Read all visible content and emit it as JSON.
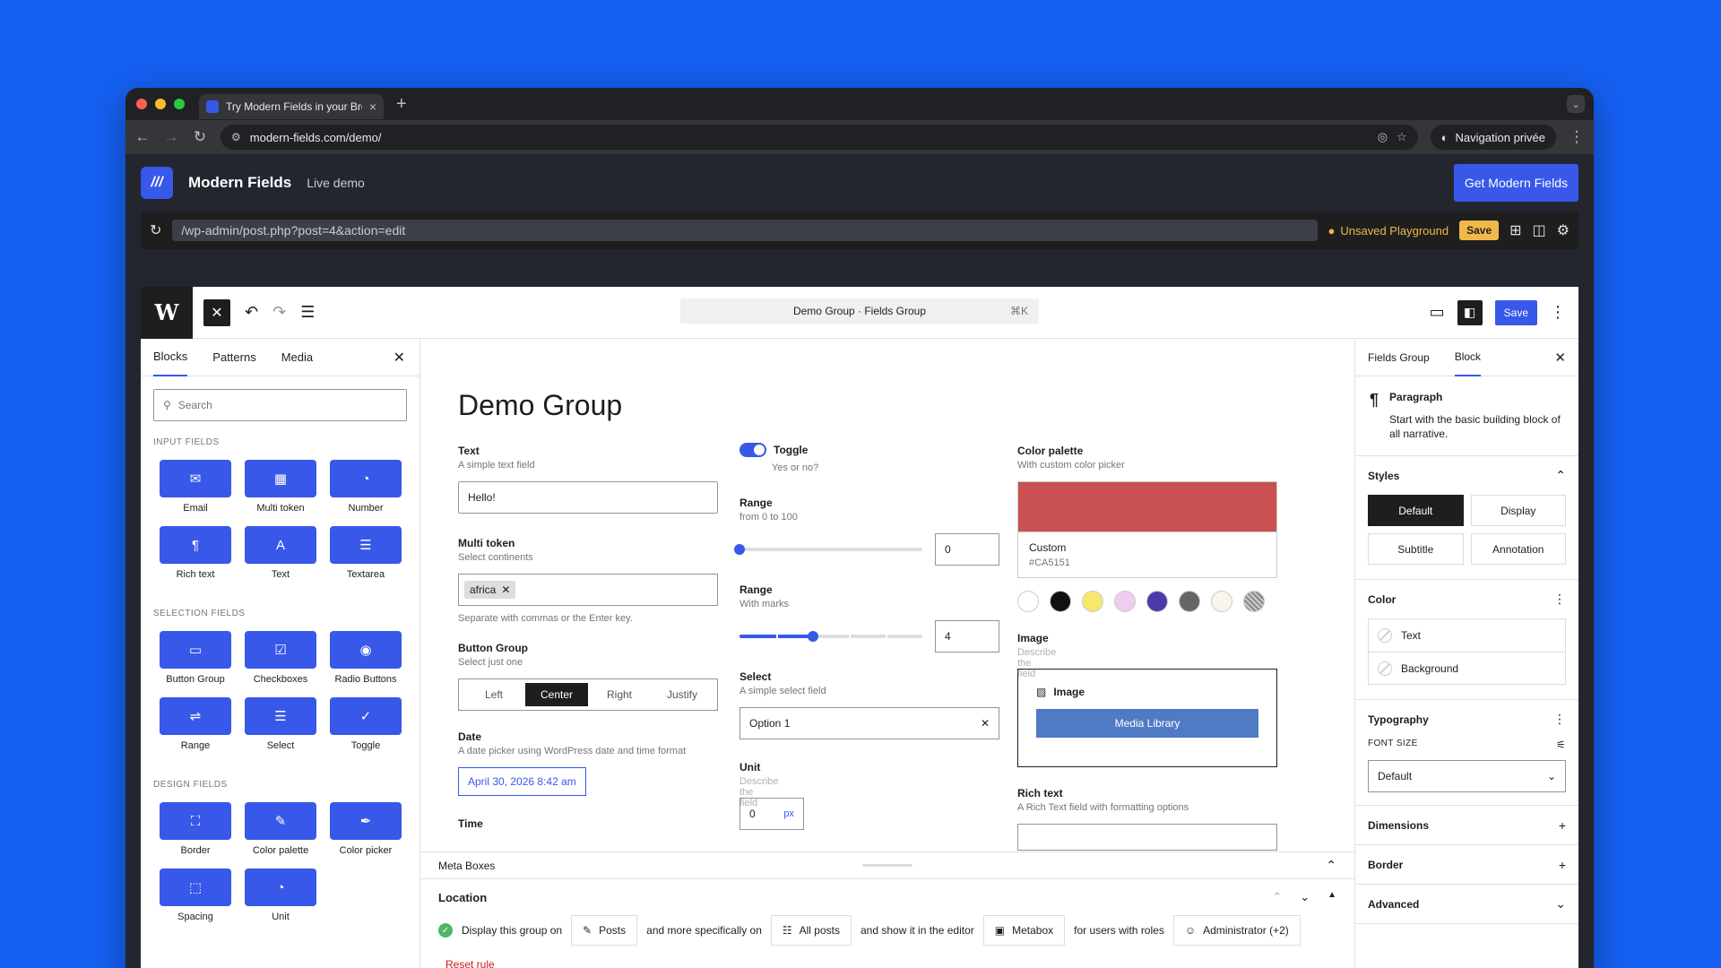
{
  "browser": {
    "tab_title": "Try Modern Fields in your Bro",
    "url": "modern-fields.com/demo/",
    "private_label": "Navigation privée"
  },
  "site": {
    "name": "Modern Fields",
    "live_label": "Live demo",
    "cta": "Get Modern Fields"
  },
  "playground": {
    "path": "/wp-admin/post.php?post=4&action=edit",
    "status": "Unsaved Playground",
    "save": "Save"
  },
  "editor": {
    "command_title": "Demo Group · Fields Group",
    "command_shortcut": "⌘K",
    "save_label": "Save"
  },
  "inserter": {
    "tabs": [
      "Blocks",
      "Patterns",
      "Media"
    ],
    "search_placeholder": "Search",
    "groups": [
      {
        "title": "INPUT FIELDS",
        "items": [
          {
            "label": "Email",
            "icon": "✉"
          },
          {
            "label": "Multi token",
            "icon": "▦"
          },
          {
            "label": "Number",
            "icon": "◔"
          },
          {
            "label": "Rich text",
            "icon": "¶"
          },
          {
            "label": "Text",
            "icon": "A"
          },
          {
            "label": "Textarea",
            "icon": "☰"
          }
        ]
      },
      {
        "title": "SELECTION FIELDS",
        "items": [
          {
            "label": "Button Group",
            "icon": "▭"
          },
          {
            "label": "Checkboxes",
            "icon": "☑"
          },
          {
            "label": "Radio Buttons",
            "icon": "◉"
          },
          {
            "label": "Range",
            "icon": "⇌"
          },
          {
            "label": "Select",
            "icon": "☰"
          },
          {
            "label": "Toggle",
            "icon": "✓"
          }
        ]
      },
      {
        "title": "DESIGN FIELDS",
        "items": [
          {
            "label": "Border",
            "icon": "⛶"
          },
          {
            "label": "Color palette",
            "icon": "✎"
          },
          {
            "label": "Color picker",
            "icon": "✒"
          },
          {
            "label": "Spacing",
            "icon": "⬚"
          },
          {
            "label": "Unit",
            "icon": "◔"
          }
        ]
      }
    ]
  },
  "canvas": {
    "title": "Demo Group",
    "text_field": {
      "label": "Text",
      "desc": "A simple text field",
      "value": "Hello!"
    },
    "multi_token": {
      "label": "Multi token",
      "desc": "Select continents",
      "token": "africa",
      "help": "Separate with commas or the Enter key."
    },
    "button_group": {
      "label": "Button Group",
      "desc": "Select just one",
      "options": [
        "Left",
        "Center",
        "Right",
        "Justify"
      ],
      "selected": "Center"
    },
    "date": {
      "label": "Date",
      "desc": "A date picker using WordPress date and time format",
      "value": "April 30, 2026 8:42 am"
    },
    "time": {
      "label": "Time"
    },
    "toggle": {
      "label": "Toggle",
      "desc": "Yes or no?"
    },
    "range1": {
      "label": "Range",
      "desc": "from 0 to 100",
      "value": "0",
      "level": 0
    },
    "range2": {
      "label": "Range",
      "desc": "With marks",
      "value": "4",
      "level": 0.4
    },
    "select": {
      "label": "Select",
      "desc": "A simple select field",
      "value": "Option 1"
    },
    "unit": {
      "label": "Unit",
      "desc": "Describe the field",
      "value": "0",
      "unit": "px"
    },
    "color_palette": {
      "label": "Color palette",
      "desc": "With custom color picker",
      "name": "Custom",
      "hex": "#CA5151",
      "color": "#ca5151",
      "swatches": [
        "#ffffff",
        "#111111",
        "#f7e76a",
        "#eecdf0",
        "#4b3aa8",
        "#666666",
        "#f8f5ea",
        "#999999"
      ]
    },
    "image": {
      "label": "Image",
      "desc": "Describe the field",
      "box_title": "Image",
      "button": "Media Library"
    },
    "rich_text": {
      "label": "Rich text",
      "desc": "A Rich Text field with formatting options"
    }
  },
  "meta": {
    "title": "Meta Boxes",
    "location_title": "Location",
    "sentence": [
      "Display this group on",
      "and more specifically on",
      "and show it in the editor",
      "for users with roles"
    ],
    "chips": [
      "Posts",
      "All posts",
      "Metabox",
      "Administrator (+2)"
    ],
    "reset": "Reset rule"
  },
  "sidebar": {
    "tabs": [
      "Fields Group",
      "Block"
    ],
    "block_name": "Paragraph",
    "block_desc": "Start with the basic building block of all narrative.",
    "styles_title": "Styles",
    "styles": [
      "Default",
      "Display",
      "Subtitle",
      "Annotation"
    ],
    "color_title": "Color",
    "colors": [
      "Text",
      "Background"
    ],
    "typography_title": "Typography",
    "font_size_label": "FONT SIZE",
    "font_size_value": "Default",
    "dimensions": "Dimensions",
    "border": "Border",
    "advanced": "Advanced"
  },
  "theme": {
    "accent": "#3858e9",
    "desktop": "#1560f2"
  }
}
